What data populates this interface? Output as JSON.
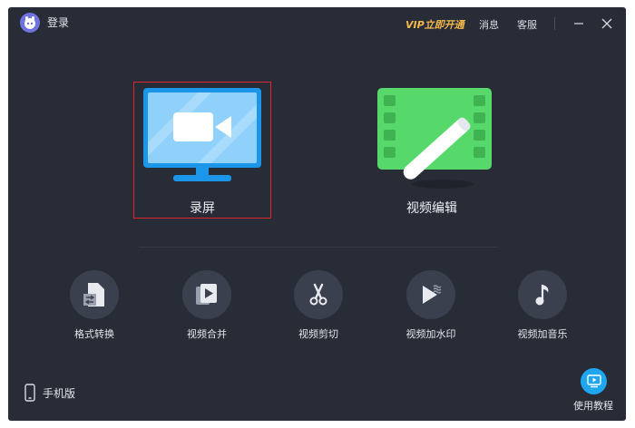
{
  "titlebar": {
    "login_label": "登录",
    "vip_label": "VIP立即开通",
    "messages_label": "消息",
    "service_label": "客服"
  },
  "main_features": [
    {
      "label": "录屏",
      "icon": "monitor-video-icon",
      "selected": true
    },
    {
      "label": "视频编辑",
      "icon": "film-pen-icon",
      "selected": false
    }
  ],
  "tools": [
    {
      "label": "格式转换",
      "icon": "file-convert-icon"
    },
    {
      "label": "视频合并",
      "icon": "video-merge-icon"
    },
    {
      "label": "视频剪切",
      "icon": "scissors-icon"
    },
    {
      "label": "视频加水印",
      "icon": "play-watermark-icon"
    },
    {
      "label": "视频加音乐",
      "icon": "music-note-icon"
    }
  ],
  "footer": {
    "mobile_label": "手机版",
    "tutorial_label": "使用教程"
  },
  "colors": {
    "background": "#282c37",
    "accent_blue": "#1fa6f0",
    "accent_green": "#56d86a",
    "vip_gold": "#f5b94a",
    "selection_red": "#e0262c"
  }
}
